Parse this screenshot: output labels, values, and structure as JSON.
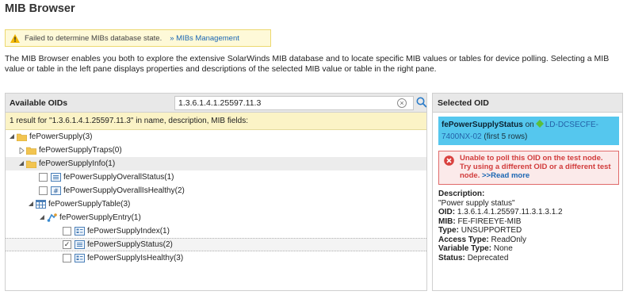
{
  "page": {
    "title": "MIB Browser"
  },
  "warning": {
    "text": "Failed to determine MIBs database state.",
    "link": "» MIBs Management"
  },
  "intro": "The MIB Browser enables you both to explore the extensive SolarWinds MIB database and to locate specific MIB values or tables for device polling. Selecting a MIB value or table in the left pane displays properties and descriptions of the selected MIB value or table in the right pane.",
  "left_panel": {
    "header": "Available OIDs",
    "search_value": "1.3.6.1.4.1.25597.11.3",
    "result_text": "1 result for \"1.3.6.1.4.1.25597.11.3\" in name, description, MIB fields:",
    "tree": [
      {
        "label": "fePowerSupply(3)"
      },
      {
        "label": "fePowerSupplyTraps(0)"
      },
      {
        "label": "fePowerSupplyInfo(1)"
      },
      {
        "label": "fePowerSupplyOverallStatus(1)"
      },
      {
        "label": "fePowerSupplyOverallIsHealthy(2)"
      },
      {
        "label": "fePowerSupplyTable(3)"
      },
      {
        "label": "fePowerSupplyEntry(1)"
      },
      {
        "label": "fePowerSupplyIndex(1)"
      },
      {
        "label": "fePowerSupplyStatus(2)"
      },
      {
        "label": "fePowerSupplyIsHealthy(3)"
      }
    ]
  },
  "right_panel": {
    "header": "Selected OID",
    "selected": {
      "name": "fePowerSupplyStatus",
      "on": "on",
      "device": "LD-DCSECFE-7400NX-02",
      "rows": "(first 5 rows)"
    },
    "error": {
      "text": "Unable to poll this OID on the test node. Try using a different OID or a different test node.",
      "link": ">>Read more"
    },
    "details": {
      "description_label": "Description:",
      "description_value": "\"Power supply status\"",
      "oid_label": "OID:",
      "oid_value": "1.3.6.1.4.1.25597.11.3.1.3.1.2",
      "mib_label": "MIB:",
      "mib_value": "FE-FIREEYE-MIB",
      "type_label": "Type:",
      "type_value": "UNSUPPORTED",
      "access_label": "Access Type:",
      "access_value": "ReadOnly",
      "variable_label": "Variable Type:",
      "variable_value": "None",
      "status_label": "Status:",
      "status_value": "Deprecated"
    }
  },
  "colors": {
    "selected_bg": "#55c7ee",
    "warning_bg": "#fef9d8",
    "result_bg": "#fbf3c6",
    "error_text": "#d13b3b",
    "link": "#1a66b3"
  }
}
